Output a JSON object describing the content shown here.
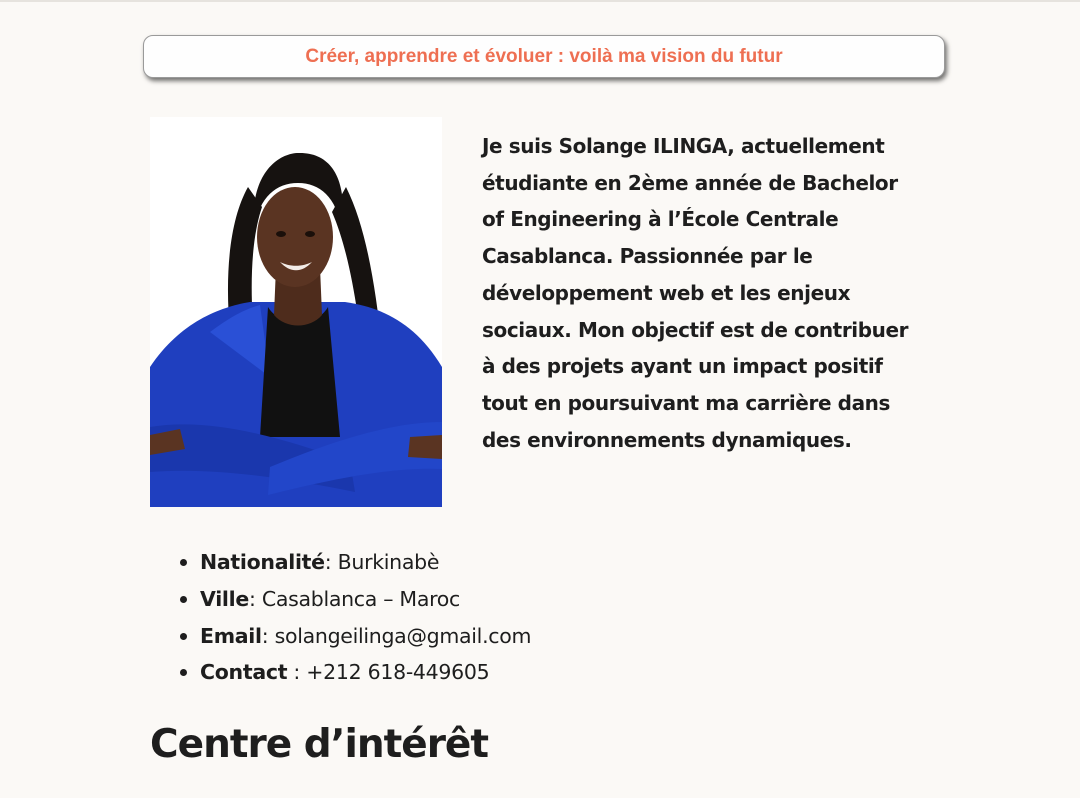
{
  "banner": {
    "text": "Créer, apprendre et évoluer : voilà ma vision du futur",
    "color": "#ee6f52"
  },
  "bio": {
    "part1": "Je suis Solange ILINGA, actuellement étudiante en 2ème année de Bachelor of Engineering à l’École Centrale Casablanca. Passionnée par le ",
    "highlight": "développement web",
    "part2": " et les enjeux sociaux. Mon objectif est de contribuer à des projets ayant un impact positif tout en poursuivant ma carrière dans des environnements dynamiques."
  },
  "facts": [
    {
      "label": "Nationalité",
      "sep": ": ",
      "value": "Burkinabè"
    },
    {
      "label": "Ville",
      "sep": ": ",
      "value": "Casablanca – Maroc"
    },
    {
      "label": "Email",
      "sep": ": ",
      "value": "solangeilinga@gmail.com"
    },
    {
      "label": "Contact",
      "sep": " : ",
      "value": "+212 618-449605"
    }
  ],
  "section": {
    "title": "Centre d’intérêt"
  },
  "portrait": {
    "icon": "profile-photo",
    "colors": {
      "jacket": "#1f3fbf",
      "shirt": "#111111",
      "skin": "#5a3422",
      "hair": "#161210"
    }
  }
}
